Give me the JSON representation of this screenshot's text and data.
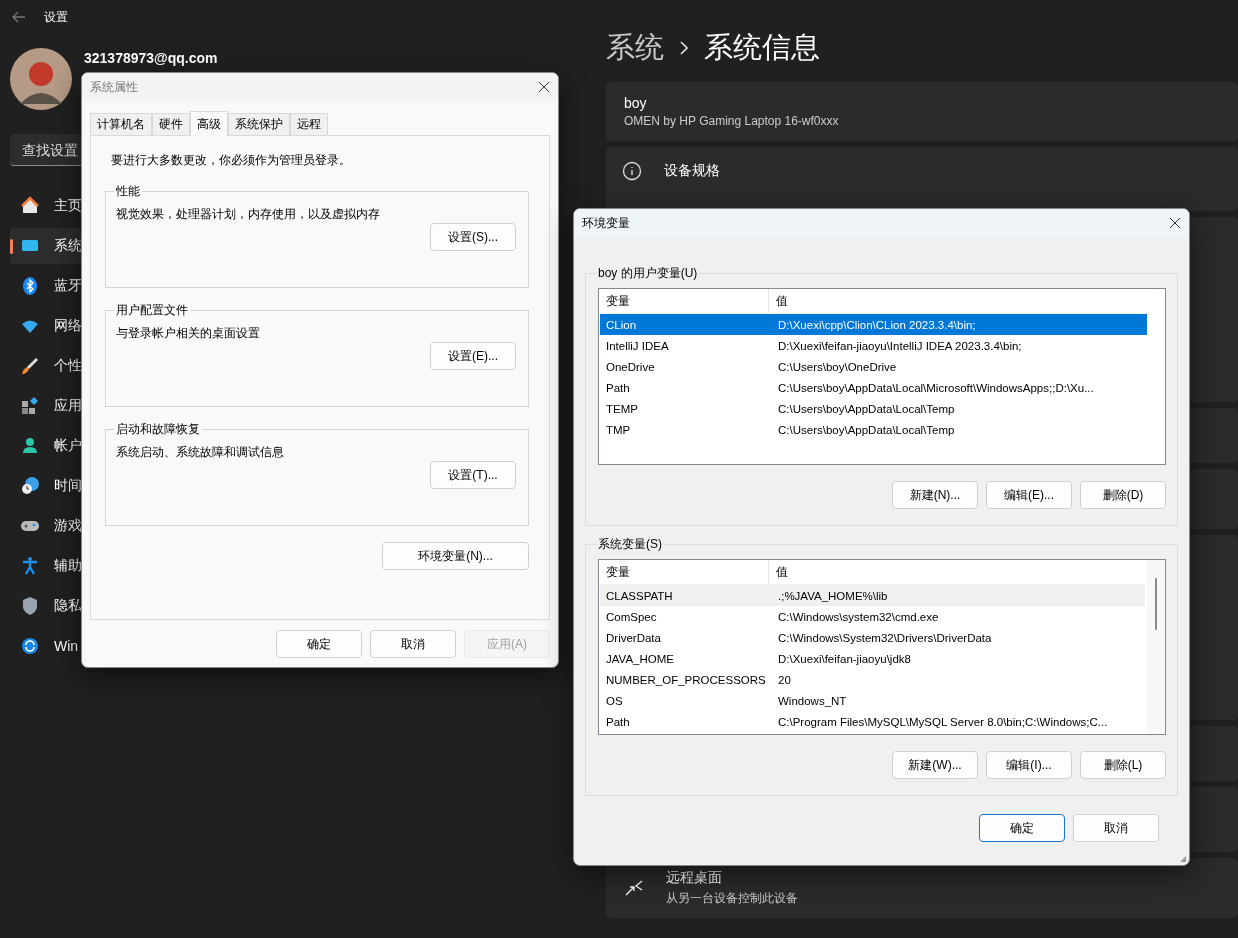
{
  "settings": {
    "title": "设置",
    "account": "321378973@qq.com",
    "search": {
      "placeholder": "查找设置"
    },
    "nav": [
      {
        "label": "主页",
        "kind": "home",
        "selected": false
      },
      {
        "label": "系统",
        "kind": "system",
        "selected": true
      },
      {
        "label": "蓝牙",
        "kind": "bluetooth",
        "selected": false
      },
      {
        "label": "网络",
        "kind": "network",
        "selected": false
      },
      {
        "label": "个性",
        "kind": "brush",
        "selected": false
      },
      {
        "label": "应用",
        "kind": "apps",
        "selected": false
      },
      {
        "label": "帐户",
        "kind": "account",
        "selected": false
      },
      {
        "label": "时间",
        "kind": "time",
        "selected": false
      },
      {
        "label": "游戏",
        "kind": "game",
        "selected": false
      },
      {
        "label": "辅助",
        "kind": "accessibility",
        "selected": false
      },
      {
        "label": "隐私",
        "kind": "shield",
        "selected": false
      },
      {
        "label": "Win",
        "kind": "update",
        "selected": false
      }
    ],
    "breadcrumb": [
      "系统",
      "系统信息"
    ],
    "device": {
      "name": "boy",
      "model": "OMEN by HP Gaming Laptop 16-wf0xxx"
    },
    "specs_title": "设备规格",
    "remote": {
      "title": "远程桌面",
      "subtitle": "从另一台设备控制此设备"
    }
  },
  "system_properties": {
    "title": "系统属性",
    "tabs": [
      {
        "label": "计算机名",
        "selected": false
      },
      {
        "label": "硬件",
        "selected": false
      },
      {
        "label": "高级",
        "selected": true
      },
      {
        "label": "系统保护",
        "selected": false
      },
      {
        "label": "远程",
        "selected": false
      }
    ],
    "notice": "要进行大多数更改，你必须作为管理员登录。",
    "groups": [
      {
        "title": "性能",
        "description": "视觉效果，处理器计划，内存使用，以及虚拟内存",
        "button": "设置(S)..."
      },
      {
        "title": "用户配置文件",
        "description": "与登录帐户相关的桌面设置",
        "button": "设置(E)..."
      },
      {
        "title": "启动和故障恢复",
        "description": "系统启动、系统故障和调试信息",
        "button": "设置(T)..."
      }
    ],
    "env_button": "环境变量(N)...",
    "buttons": [
      {
        "label": "确定",
        "disabled": false
      },
      {
        "label": "取消",
        "disabled": false
      },
      {
        "label": "应用(A)",
        "disabled": true
      }
    ]
  },
  "environment_variables": {
    "title": "环境变量",
    "lists": [
      {
        "title": "boy 的用户变量(U)",
        "focused": true,
        "columns": [
          "变量",
          "值"
        ],
        "rows": [
          {
            "name": "CLion",
            "value": "D:\\Xuexi\\cpp\\Clion\\CLion 2023.3.4\\bin;",
            "selected": true
          },
          {
            "name": "IntelliJ IDEA",
            "value": "D:\\Xuexi\\feifan-jiaoyu\\IntelliJ IDEA 2023.3.4\\bin;",
            "selected": false
          },
          {
            "name": "OneDrive",
            "value": "C:\\Users\\boy\\OneDrive",
            "selected": false
          },
          {
            "name": "Path",
            "value": "C:\\Users\\boy\\AppData\\Local\\Microsoft\\WindowsApps;;D:\\Xu...",
            "selected": false
          },
          {
            "name": "TEMP",
            "value": "C:\\Users\\boy\\AppData\\Local\\Temp",
            "selected": false
          },
          {
            "name": "TMP",
            "value": "C:\\Users\\boy\\AppData\\Local\\Temp",
            "selected": false
          }
        ],
        "buttons": [
          "新建(N)...",
          "编辑(E)...",
          "删除(D)"
        ]
      },
      {
        "title": "系统变量(S)",
        "focused": false,
        "columns": [
          "变量",
          "值"
        ],
        "rows": [
          {
            "name": "CLASSPATH",
            "value": ".;%JAVA_HOME%\\lib",
            "selected": true
          },
          {
            "name": "ComSpec",
            "value": "C:\\Windows\\system32\\cmd.exe",
            "selected": false
          },
          {
            "name": "DriverData",
            "value": "C:\\Windows\\System32\\Drivers\\DriverData",
            "selected": false
          },
          {
            "name": "JAVA_HOME",
            "value": "D:\\Xuexi\\feifan-jiaoyu\\jdk8",
            "selected": false
          },
          {
            "name": "NUMBER_OF_PROCESSORS",
            "value": "20",
            "selected": false
          },
          {
            "name": "OS",
            "value": "Windows_NT",
            "selected": false
          },
          {
            "name": "Path",
            "value": "C:\\Program Files\\MySQL\\MySQL Server 8.0\\bin;C:\\Windows;C...",
            "selected": false
          }
        ],
        "buttons": [
          "新建(W)...",
          "编辑(I)...",
          "删除(L)"
        ]
      }
    ],
    "buttons": [
      {
        "label": "确定",
        "default": true
      },
      {
        "label": "取消",
        "default": false
      }
    ]
  }
}
